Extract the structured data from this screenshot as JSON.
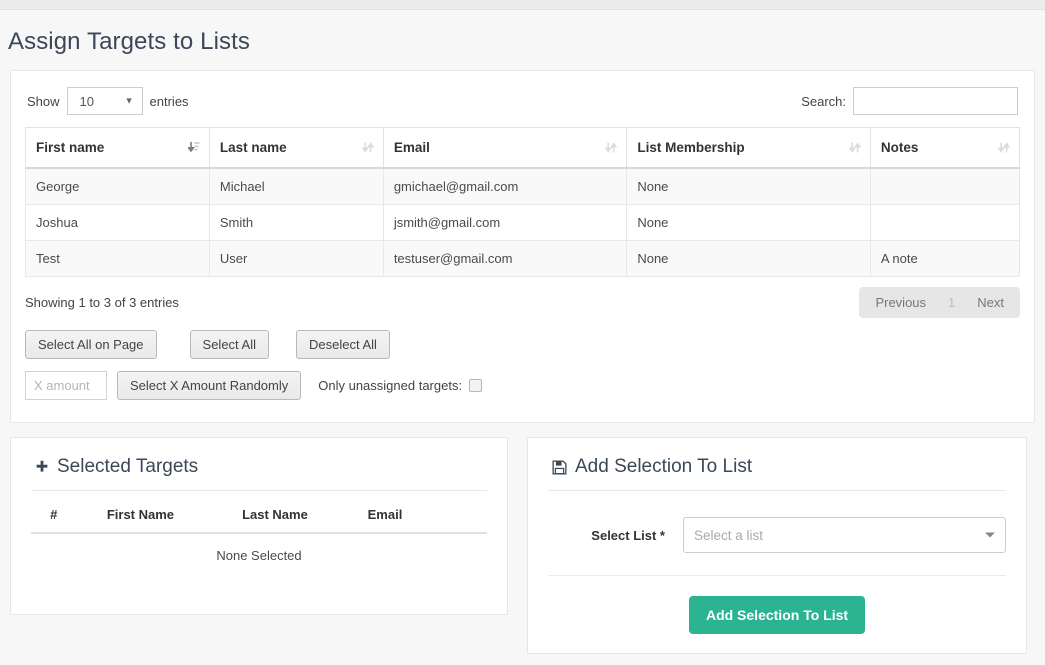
{
  "page": {
    "title": "Assign Targets to Lists",
    "accent_green": "#2bb392",
    "paging_bg": "#e6e6e6"
  },
  "datatable": {
    "length_label_before": "Show",
    "length_label_after": "entries",
    "length_value": "10",
    "search_label": "Search:",
    "search_value": "",
    "search_placeholder": "",
    "columns": [
      {
        "label": "First name",
        "sort": "asc"
      },
      {
        "label": "Last name",
        "sort": "none"
      },
      {
        "label": "Email",
        "sort": "none"
      },
      {
        "label": "List Membership",
        "sort": "none"
      },
      {
        "label": "Notes",
        "sort": "none"
      }
    ],
    "rows": [
      {
        "first": "George",
        "last": "Michael",
        "email": "gmichael@gmail.com",
        "membership": "None",
        "notes": ""
      },
      {
        "first": "Joshua",
        "last": "Smith",
        "email": "jsmith@gmail.com",
        "membership": "None",
        "notes": ""
      },
      {
        "first": "Test",
        "last": "User",
        "email": "testuser@gmail.com",
        "membership": "None",
        "notes": "A note"
      }
    ],
    "info": "Showing 1 to 3 of 3 entries",
    "paging": {
      "previous": "Previous",
      "current_page": "1",
      "next": "Next"
    }
  },
  "actions": {
    "select_all_on_page": "Select All on Page",
    "select_all": "Select All",
    "deselect_all": "Deselect All",
    "x_amount_value": "",
    "x_amount_placeholder": "X amount",
    "select_x_randomly": "Select X Amount Randomly",
    "only_unassigned_label": "Only unassigned targets:",
    "only_unassigned_checked": false
  },
  "selected_targets": {
    "icon": "plus-icon",
    "title": "Selected Targets",
    "columns": [
      "#",
      "First Name",
      "Last Name",
      "Email"
    ],
    "empty_text": "None Selected"
  },
  "add_to_list": {
    "icon": "save-icon",
    "title": "Add Selection To List",
    "field_label": "Select List *",
    "select_value": "",
    "select_placeholder": "Select a list",
    "submit_label": "Add Selection To List"
  }
}
